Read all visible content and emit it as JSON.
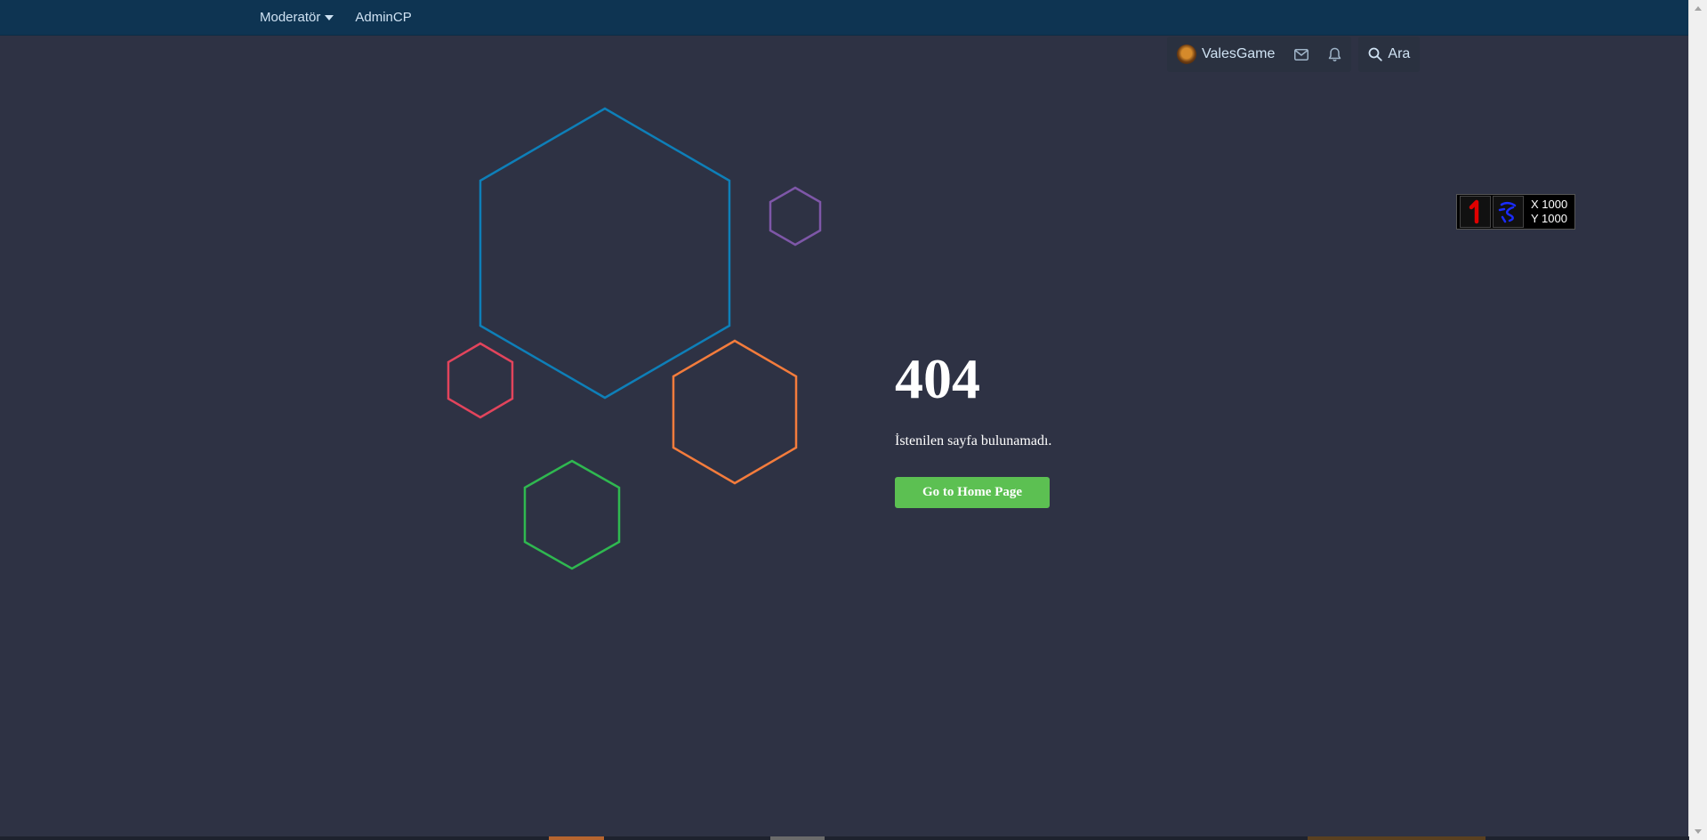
{
  "topnav": {
    "moderator_label": "Moderatör",
    "admincp_label": "AdminCP"
  },
  "userbar": {
    "username": "ValesGame",
    "search_label": "Ara"
  },
  "error": {
    "code": "404",
    "message": "İstenilen sayfa bulunamadı.",
    "home_button": "Go to Home Page"
  },
  "coord_widget": {
    "x_text": "X 1000",
    "y_text": "Y 1000"
  },
  "colors": {
    "background": "#2e3244",
    "topbar": "#0e3452",
    "button_green": "#5cc052",
    "hex_blue": "#0e7fb8",
    "hex_purple": "#7e57a8",
    "hex_red": "#e2445c",
    "hex_orange": "#f47c3c",
    "hex_green": "#2fb850"
  }
}
